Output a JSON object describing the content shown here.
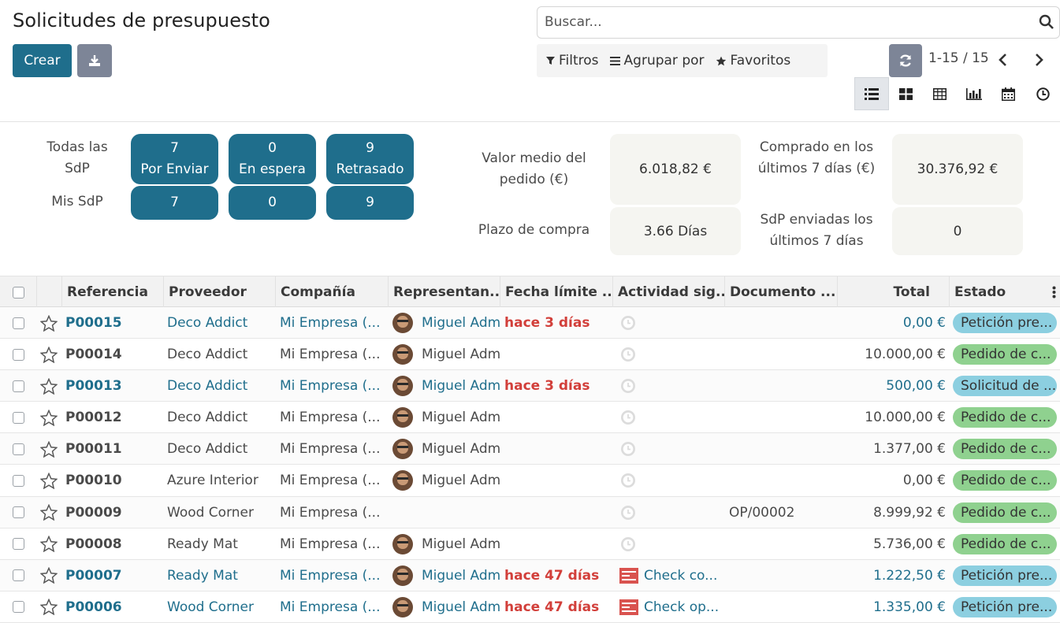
{
  "page": {
    "title": "Solicitudes de presupuesto",
    "create_label": "Crear"
  },
  "search": {
    "placeholder": "Buscar..."
  },
  "filters": {
    "filter_label": "Filtros",
    "group_label": "Agrupar por",
    "favorites_label": "Favoritos"
  },
  "pager": {
    "text": "1-15 / 15"
  },
  "dashboard": {
    "all_label": "Todas las SdP",
    "mine_label": "Mis SdP",
    "buttons": [
      {
        "count": "7",
        "label": "Por Enviar",
        "mine": "7"
      },
      {
        "count": "0",
        "label": "En espera",
        "mine": "0"
      },
      {
        "count": "9",
        "label": "Retrasado",
        "mine": "9"
      }
    ],
    "kpis": [
      {
        "label": "Valor medio del pedido (€)",
        "value": "6.018,82 €"
      },
      {
        "label": "Comprado en los últimos 7 días (€)",
        "value": "30.376,92 €"
      },
      {
        "label": "Plazo de compra",
        "value": "3.66  Días"
      },
      {
        "label": "SdP enviadas los últimos 7 días",
        "value": "0"
      }
    ]
  },
  "table": {
    "columns": [
      "Referencia",
      "Proveedor",
      "Compañía",
      "Representan...",
      "Fecha límite ...",
      "Actividad sig...",
      "Documento ...",
      "Total",
      "Estado"
    ],
    "rows": [
      {
        "ref": "P00015",
        "vendor": "Deco Addict",
        "company": "Mi Empresa (...",
        "rep": "Miguel Adm",
        "deadline": "hace 3 días",
        "activity": "",
        "source": "",
        "total": "0,00 €",
        "status": "Petición pre...",
        "status_color": "teal",
        "highlight": true
      },
      {
        "ref": "P00014",
        "vendor": "Deco Addict",
        "company": "Mi Empresa (...",
        "rep": "Miguel Adm",
        "deadline": "",
        "activity": "",
        "source": "",
        "total": "10.000,00 €",
        "status": "Pedido de c...",
        "status_color": "green",
        "highlight": false
      },
      {
        "ref": "P00013",
        "vendor": "Deco Addict",
        "company": "Mi Empresa (...",
        "rep": "Miguel Adm",
        "deadline": "hace 3 días",
        "activity": "",
        "source": "",
        "total": "500,00 €",
        "status": "Solicitud de ...",
        "status_color": "teal",
        "highlight": true
      },
      {
        "ref": "P00012",
        "vendor": "Deco Addict",
        "company": "Mi Empresa (...",
        "rep": "Miguel Adm",
        "deadline": "",
        "activity": "",
        "source": "",
        "total": "10.000,00 €",
        "status": "Pedido de c...",
        "status_color": "green",
        "highlight": false
      },
      {
        "ref": "P00011",
        "vendor": "Deco Addict",
        "company": "Mi Empresa (...",
        "rep": "Miguel Adm",
        "deadline": "",
        "activity": "",
        "source": "",
        "total": "1.377,00 €",
        "status": "Pedido de c...",
        "status_color": "green",
        "highlight": false
      },
      {
        "ref": "P00010",
        "vendor": "Azure Interior",
        "company": "Mi Empresa (...",
        "rep": "Miguel Adm",
        "deadline": "",
        "activity": "",
        "source": "",
        "total": "0,00 €",
        "status": "Pedido de c...",
        "status_color": "green",
        "highlight": false
      },
      {
        "ref": "P00009",
        "vendor": "Wood Corner",
        "company": "Mi Empresa (...",
        "rep": "",
        "deadline": "",
        "activity": "",
        "source": "OP/00002",
        "total": "8.999,92 €",
        "status": "Pedido de c...",
        "status_color": "green",
        "highlight": false
      },
      {
        "ref": "P00008",
        "vendor": "Ready Mat",
        "company": "Mi Empresa (...",
        "rep": "Miguel Adm",
        "deadline": "",
        "activity": "",
        "source": "",
        "total": "5.736,00 €",
        "status": "Pedido de c...",
        "status_color": "green",
        "highlight": false
      },
      {
        "ref": "P00007",
        "vendor": "Ready Mat",
        "company": "Mi Empresa (...",
        "rep": "Miguel Adm",
        "deadline": "hace 47 días",
        "activity": "Check co...",
        "source": "",
        "total": "1.222,50 €",
        "status": "Petición pre...",
        "status_color": "teal",
        "highlight": true
      },
      {
        "ref": "P00006",
        "vendor": "Wood Corner",
        "company": "Mi Empresa (...",
        "rep": "Miguel Adm",
        "deadline": "hace 47 días",
        "activity": "Check op...",
        "source": "",
        "total": "1.335,00 €",
        "status": "Petición pre...",
        "status_color": "teal",
        "highlight": true
      }
    ]
  },
  "colors": {
    "primary": "#1f6e8c",
    "secondary": "#7d8597",
    "danger": "#d23f3a",
    "badge_green": "#8fd18f",
    "badge_teal": "#8ccfe0"
  },
  "icons": [
    "download-icon",
    "search-icon",
    "filter-icon",
    "group-by-icon",
    "star-icon",
    "reload-icon",
    "chevron-left-icon",
    "chevron-right-icon",
    "list-view-icon",
    "kanban-view-icon",
    "pivot-view-icon",
    "graph-view-icon",
    "calendar-view-icon",
    "activity-view-icon",
    "clock-icon",
    "mail-activity-icon",
    "column-options-icon"
  ]
}
